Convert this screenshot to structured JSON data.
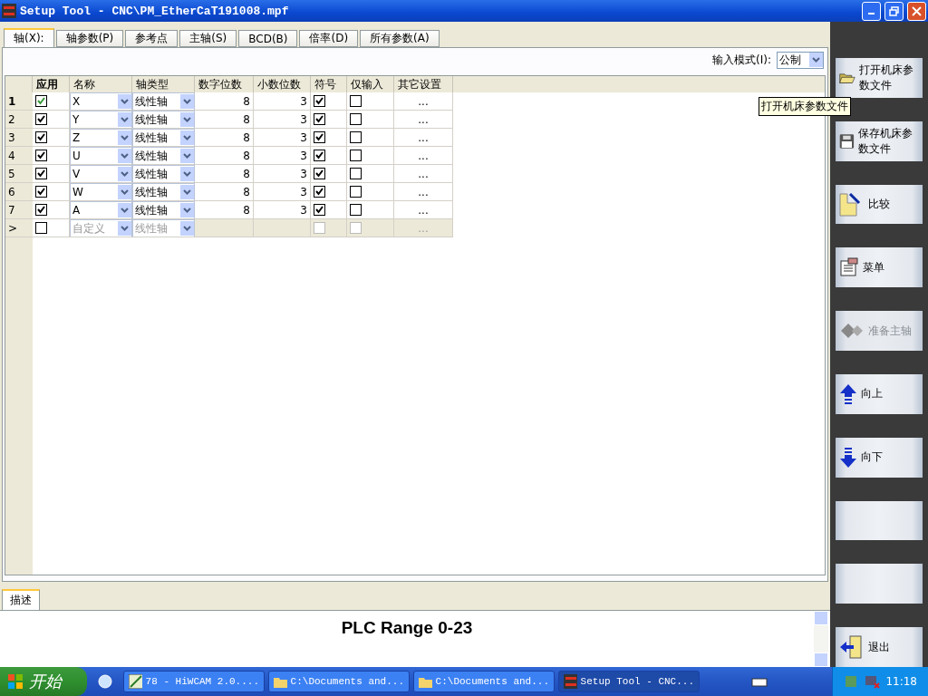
{
  "window": {
    "title": "Setup Tool - CNC\\PM_EtherCaT191008.mpf"
  },
  "tabs": [
    {
      "label": "轴(X):",
      "selected": true
    },
    {
      "label": "轴参数(P)",
      "selected": false
    },
    {
      "label": "参考点",
      "selected": false
    },
    {
      "label": "主轴(S)",
      "selected": false
    },
    {
      "label": "BCD(B)",
      "selected": false
    },
    {
      "label": "倍率(D)",
      "selected": false
    },
    {
      "label": "所有参数(A)",
      "selected": false
    }
  ],
  "input_mode": {
    "label": "输入模式(I):",
    "value": "公制"
  },
  "table": {
    "columns": [
      "应用",
      "名称",
      "轴类型",
      "数字位数",
      "小数位数",
      "符号",
      "仅输入",
      "其它设置"
    ],
    "rows": [
      {
        "kind": "axis",
        "header": "1",
        "apply": true,
        "focused": true,
        "name": "X",
        "type": "线性轴",
        "digits": "8",
        "decimals": "3",
        "sign": true,
        "input_only": false,
        "other": "..."
      },
      {
        "kind": "axis",
        "header": "2",
        "apply": true,
        "focused": false,
        "name": "Y",
        "type": "线性轴",
        "digits": "8",
        "decimals": "3",
        "sign": true,
        "input_only": false,
        "other": "..."
      },
      {
        "kind": "axis",
        "header": "3",
        "apply": true,
        "focused": false,
        "name": "Z",
        "type": "线性轴",
        "digits": "8",
        "decimals": "3",
        "sign": true,
        "input_only": false,
        "other": "..."
      },
      {
        "kind": "axis",
        "header": "4",
        "apply": true,
        "focused": false,
        "name": "U",
        "type": "线性轴",
        "digits": "8",
        "decimals": "3",
        "sign": true,
        "input_only": false,
        "other": "..."
      },
      {
        "kind": "axis",
        "header": "5",
        "apply": true,
        "focused": false,
        "name": "V",
        "type": "线性轴",
        "digits": "8",
        "decimals": "3",
        "sign": true,
        "input_only": false,
        "other": "..."
      },
      {
        "kind": "axis",
        "header": "6",
        "apply": true,
        "focused": false,
        "name": "W",
        "type": "线性轴",
        "digits": "8",
        "decimals": "3",
        "sign": true,
        "input_only": false,
        "other": "..."
      },
      {
        "kind": "axis",
        "header": "7",
        "apply": true,
        "focused": false,
        "name": "A",
        "type": "线性轴",
        "digits": "8",
        "decimals": "3",
        "sign": true,
        "input_only": false,
        "other": "..."
      },
      {
        "kind": "new",
        "header": ">",
        "apply": false,
        "focused": false,
        "name": "自定义",
        "type": "线性轴",
        "digits": "",
        "decimals": "",
        "sign": false,
        "input_only": false,
        "other": "..."
      }
    ]
  },
  "tooltip": "打开机床参数文件",
  "description": {
    "tab": "描述",
    "title": "PLC Range 0-23"
  },
  "sidebar": {
    "buttons": [
      {
        "kind": "folder",
        "label": "打开机床参数文件",
        "disabled": false
      },
      {
        "kind": "disk",
        "label": "保存机床参数文件",
        "disabled": false
      },
      {
        "kind": "compare",
        "label": "比较",
        "disabled": false
      },
      {
        "kind": "menu",
        "label": "菜单",
        "disabled": false
      },
      {
        "kind": "spindle",
        "label": "准备主轴",
        "disabled": true
      },
      {
        "kind": "up",
        "label": "向上",
        "disabled": false
      },
      {
        "kind": "down",
        "label": "向下",
        "disabled": false
      },
      {
        "kind": "blank"
      },
      {
        "kind": "blank"
      },
      {
        "kind": "exit",
        "label": "退出",
        "disabled": false
      }
    ]
  },
  "taskbar": {
    "start": "开始",
    "tasks": [
      {
        "kind": "app",
        "label": "78 - HiWCAM 2.0....",
        "selected": false
      },
      {
        "kind": "folder",
        "label": "C:\\Documents and...",
        "selected": false
      },
      {
        "kind": "folder",
        "label": "C:\\Documents and...",
        "selected": false
      },
      {
        "kind": "setup",
        "label": "Setup Tool - CNC...",
        "selected": true
      }
    ],
    "clock": "11:18"
  }
}
